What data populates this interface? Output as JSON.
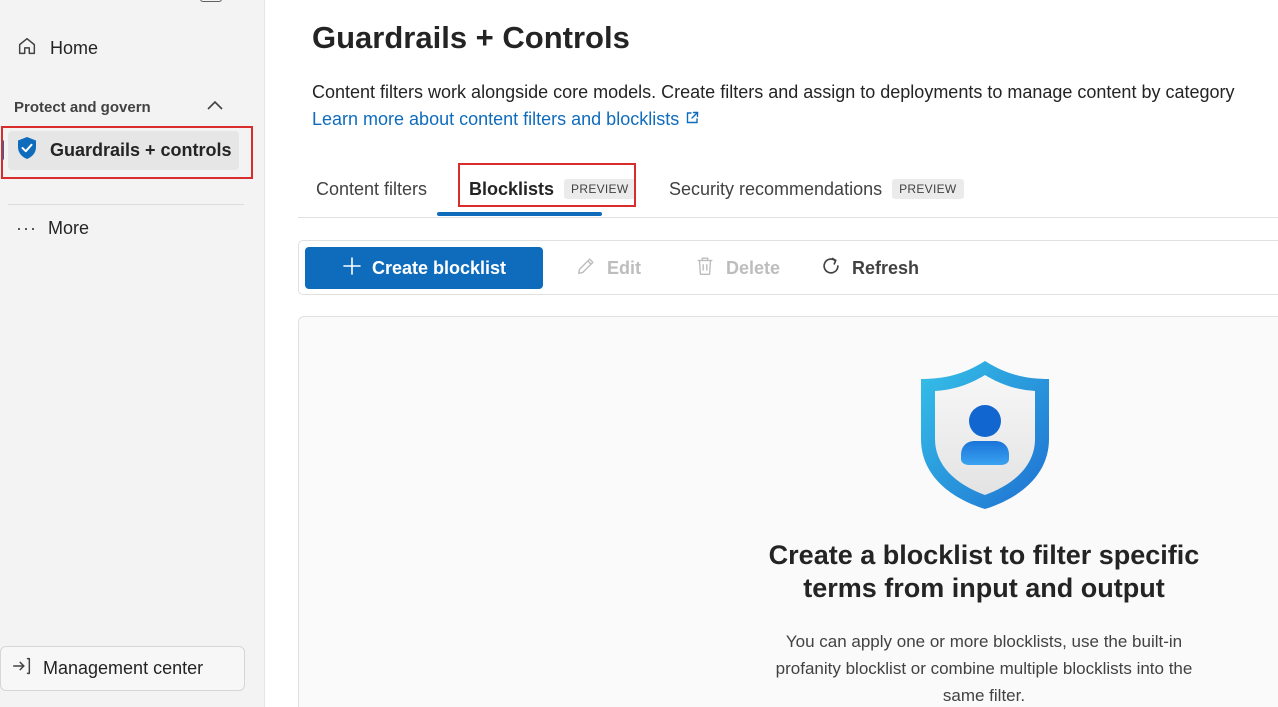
{
  "sidebar": {
    "home_label": "Home",
    "section_label": "Protect and govern",
    "active_item_label": "Guardrails + controls",
    "more_label": "More",
    "management_label": "Management center"
  },
  "page": {
    "title": "Guardrails + Controls",
    "description": "Content filters work alongside core models. Create filters and assign to deployments to manage content by category",
    "learn_more_link": "Learn more about content filters and blocklists"
  },
  "tabs": [
    {
      "label": "Content filters",
      "badge": "",
      "selected": false
    },
    {
      "label": "Blocklists",
      "badge": "PREVIEW",
      "selected": true
    },
    {
      "label": "Security recommendations",
      "badge": "PREVIEW",
      "selected": false
    }
  ],
  "toolbar": {
    "create_label": "Create blocklist",
    "edit_label": "Edit",
    "delete_label": "Delete",
    "refresh_label": "Refresh"
  },
  "empty_state": {
    "title": "Create a blocklist to filter specific terms from input and output",
    "description": "You can apply one or more blocklists, use the built-in profanity blocklist or combine multiple blocklists into the same filter."
  },
  "colors": {
    "accent": "#0f6cbd",
    "highlight": "#d92c2c",
    "sidebar_bg": "#f3f3f3"
  },
  "icons": {
    "home": "home-icon",
    "chevron": "chevron-up-icon",
    "shield": "shield-icon",
    "more": "more-dots-icon",
    "management": "sign-in-arrow-icon",
    "external": "external-link-icon",
    "add": "plus-icon",
    "edit": "pencil-icon",
    "delete": "trash-icon",
    "refresh": "refresh-icon"
  }
}
